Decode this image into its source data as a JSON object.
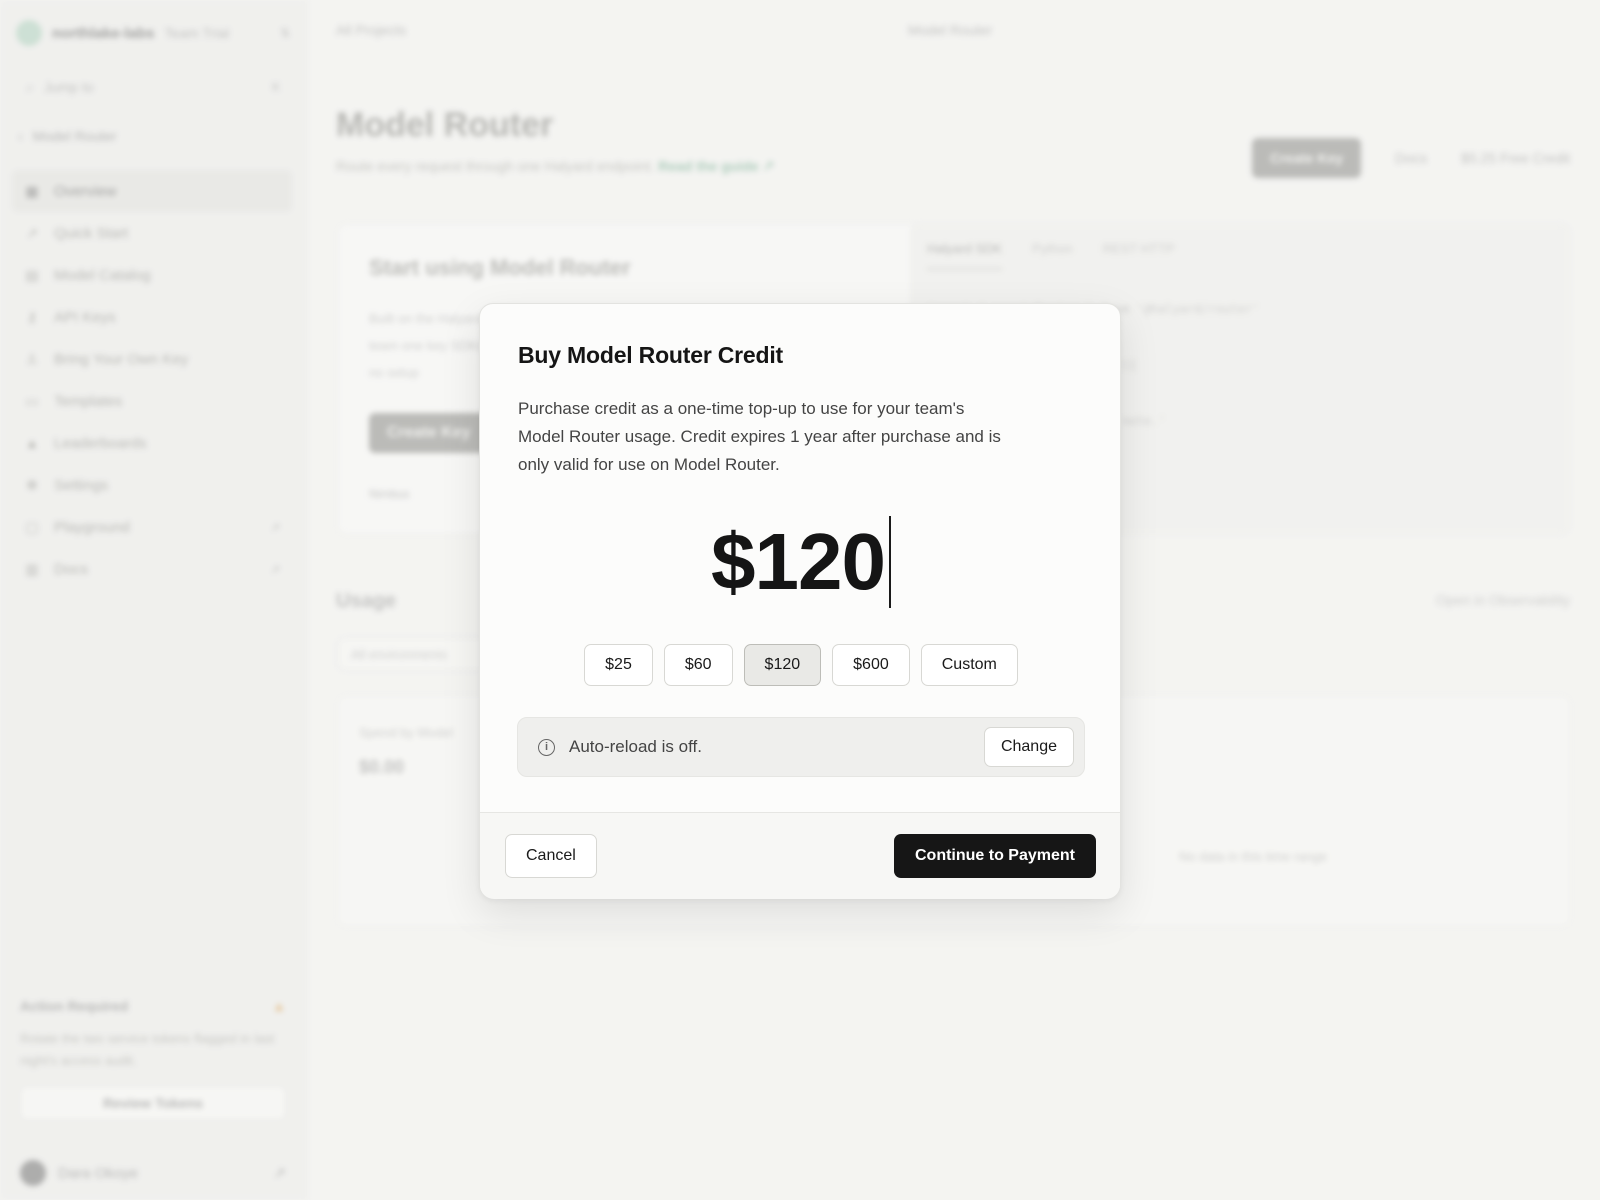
{
  "sidebar": {
    "team_name": "northlake-labs",
    "team_plan": "Team Trial",
    "search_placeholder": "Jump to",
    "search_shortcut": "K",
    "back_label": "Model Router",
    "items": [
      {
        "label": "Overview",
        "icon": "grid-icon"
      },
      {
        "label": "Quick Start",
        "icon": "rocket-icon"
      },
      {
        "label": "Model Catalog",
        "icon": "catalog-icon"
      },
      {
        "label": "API Keys",
        "icon": "key-icon"
      },
      {
        "label": "Bring Your Own Key",
        "icon": "user-key-icon"
      },
      {
        "label": "Templates",
        "icon": "folder-icon"
      },
      {
        "label": "Leaderboards",
        "icon": "chart-icon"
      },
      {
        "label": "Settings",
        "icon": "gear-icon"
      },
      {
        "label": "Playground",
        "icon": "chat-icon"
      },
      {
        "label": "Docs",
        "icon": "book-icon"
      }
    ],
    "alert": {
      "title": "Action Required",
      "body": "Rotate the two service tokens flagged in last night's access audit.",
      "button": "Review Tokens"
    },
    "user_name": "Dara Okoye"
  },
  "topbar": {
    "breadcrumb": "All Projects",
    "title": "Model Router"
  },
  "page": {
    "title": "Model Router",
    "subtitle": "Route every request through one Halyard endpoint.",
    "guide_link": "Read the guide ↗",
    "create_key": "Create Key",
    "docs": "Docs",
    "free_credit": "$5.25 Free Credit"
  },
  "start_card": {
    "title": "Start using Model Router",
    "description": "Built on the Halyard team one key SDKs, no setup",
    "button": "Create Key",
    "meta": "Nimbus"
  },
  "code_panel": {
    "tabs": [
      "Halyard SDK",
      "Python",
      "REST HTTP"
    ],
    "lines": [
      "import { createRouter } from '@halyard/router'",
      "",
      "const router = createRouter({",
      "  model: 'atlas-3',",
      "  prompt: 'Draft a release note.'"
    ]
  },
  "usage": {
    "title": "Usage",
    "filter": "All environments",
    "open_link": "Open in Observability",
    "card_label": "Spend by Model",
    "card_value": "$0.00",
    "empty": "No data in this time range"
  },
  "modal": {
    "title": "Buy Model Router Credit",
    "description": "Purchase credit as a one-time top-up to use for your team's Model Router usage. Credit expires 1 year after purchase and is only valid for use on Model Router.",
    "amount": "$120",
    "presets": [
      {
        "label": "$25",
        "selected": false
      },
      {
        "label": "$60",
        "selected": false
      },
      {
        "label": "$120",
        "selected": true
      },
      {
        "label": "$600",
        "selected": false
      },
      {
        "label": "Custom",
        "selected": false
      }
    ],
    "auto_reload_text": "Auto-reload is off.",
    "change_label": "Change",
    "cancel_label": "Cancel",
    "continue_label": "Continue to Payment"
  }
}
